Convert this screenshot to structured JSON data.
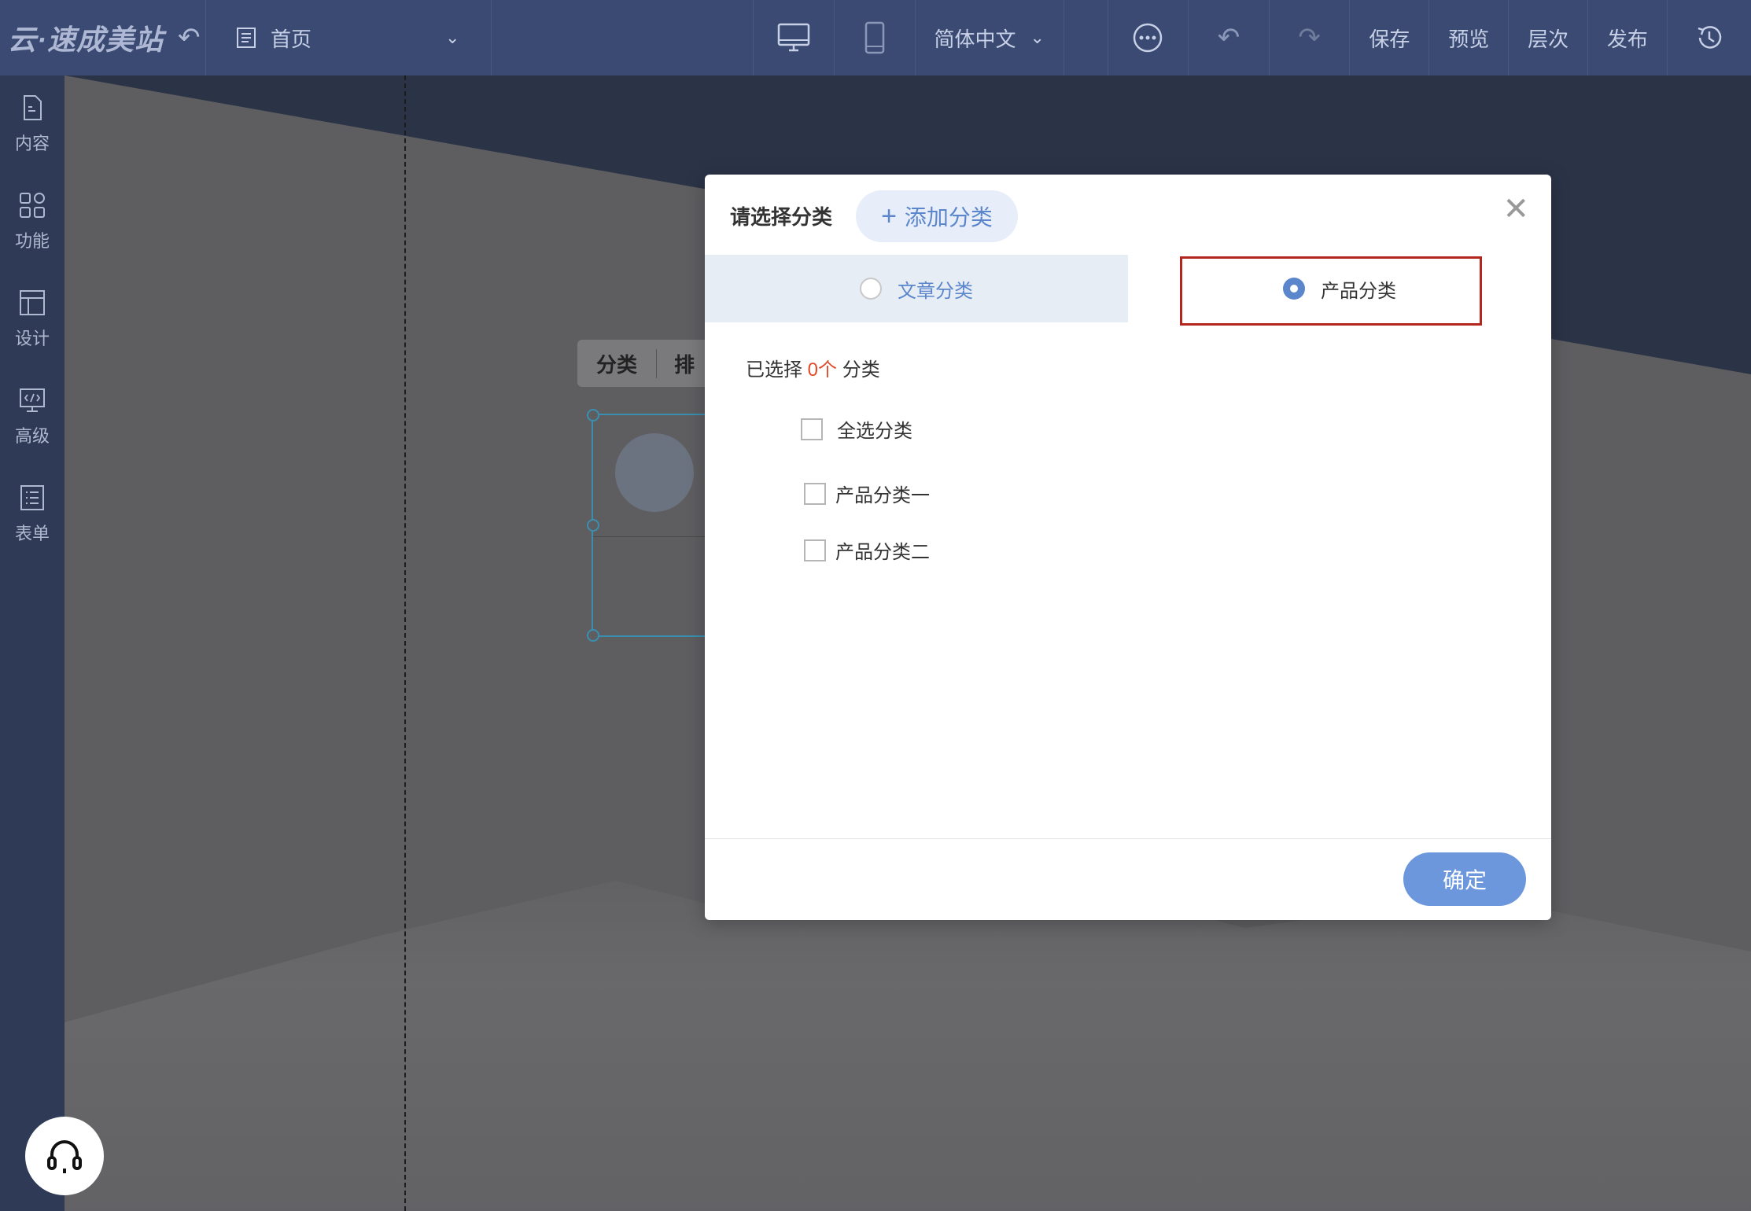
{
  "topbar": {
    "brand": "云·速成美站",
    "page_selector": "首页",
    "language": "简体中文",
    "save": "保存",
    "preview": "预览",
    "layers": "层次",
    "publish": "发布"
  },
  "sidebar": {
    "items": [
      {
        "label": "内容",
        "icon": "document-icon"
      },
      {
        "label": "功能",
        "icon": "grid-icon"
      },
      {
        "label": "设计",
        "icon": "layout-icon"
      },
      {
        "label": "高级",
        "icon": "code-monitor-icon"
      },
      {
        "label": "表单",
        "icon": "list-icon"
      }
    ]
  },
  "canvas": {
    "mini_toolbar": [
      "分类",
      "排"
    ]
  },
  "modal": {
    "title": "请选择分类",
    "add_button": "添加分类",
    "tabs": [
      {
        "label": "文章分类",
        "selected": false
      },
      {
        "label": "产品分类",
        "selected": true
      }
    ],
    "selected_prefix": "已选择",
    "selected_count": "0个",
    "selected_suffix": "分类",
    "select_all": "全选分类",
    "categories": [
      "产品分类一",
      "产品分类二"
    ],
    "confirm": "确定"
  },
  "colors": {
    "topbar": "#3a4a72",
    "accent": "#5b86cc",
    "highlight": "#b3261e",
    "count": "#e04b2a"
  }
}
